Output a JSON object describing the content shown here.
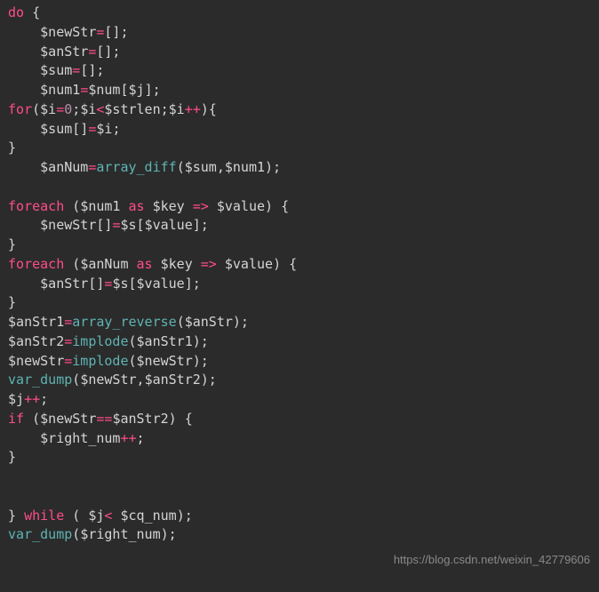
{
  "watermark": "https://blog.csdn.net/weixin_42779606",
  "lines": [
    " <span class='kw'>do</span> <span class='pun'>{</span>",
    "     <span class='var'>$newStr</span><span class='op'>=</span><span class='pun'>[];</span>",
    "     <span class='var'>$anStr</span><span class='op'>=</span><span class='pun'>[];</span>",
    "     <span class='var'>$sum</span><span class='op'>=</span><span class='pun'>[];</span>",
    "     <span class='var'>$num1</span><span class='op'>=</span><span class='var'>$num</span><span class='pun'>[</span><span class='var'>$j</span><span class='pun'>];</span>",
    " <span class='kw'>for</span><span class='pun'>(</span><span class='var'>$i</span><span class='op'>=</span><span class='num'>0</span><span class='pun'>;</span><span class='var'>$i</span><span class='op'>&lt;</span><span class='var'>$strlen</span><span class='pun'>;</span><span class='var'>$i</span><span class='op'>++</span><span class='pun'>){</span>",
    "     <span class='var'>$sum</span><span class='pun'>[]</span><span class='op'>=</span><span class='var'>$i</span><span class='pun'>;</span>",
    " <span class='pun'>}</span>",
    "     <span class='var'>$anNum</span><span class='op'>=</span><span class='call'>array_diff</span><span class='pun'>(</span><span class='var'>$sum</span><span class='pun'>,</span><span class='var'>$num1</span><span class='pun'>);</span>",
    "",
    " <span class='kw'>foreach</span> <span class='pun'>(</span><span class='var'>$num1</span> <span class='kw'>as</span> <span class='var'>$key</span> <span class='op'>=&gt;</span> <span class='var'>$value</span><span class='pun'>) {</span>",
    "     <span class='var'>$newStr</span><span class='pun'>[]</span><span class='op'>=</span><span class='var'>$s</span><span class='pun'>[</span><span class='var'>$value</span><span class='pun'>];</span>",
    " <span class='pun'>}</span>",
    " <span class='kw'>foreach</span> <span class='pun'>(</span><span class='var'>$anNum</span> <span class='kw'>as</span> <span class='var'>$key</span> <span class='op'>=&gt;</span> <span class='var'>$value</span><span class='pun'>) {</span>",
    "     <span class='var'>$anStr</span><span class='pun'>[]</span><span class='op'>=</span><span class='var'>$s</span><span class='pun'>[</span><span class='var'>$value</span><span class='pun'>];</span>",
    " <span class='pun'>}</span>",
    " <span class='var'>$anStr1</span><span class='op'>=</span><span class='call'>array_reverse</span><span class='pun'>(</span><span class='var'>$anStr</span><span class='pun'>);</span>",
    " <span class='var'>$anStr2</span><span class='op'>=</span><span class='call'>implode</span><span class='pun'>(</span><span class='var'>$anStr1</span><span class='pun'>);</span>",
    " <span class='var'>$newStr</span><span class='op'>=</span><span class='call'>implode</span><span class='pun'>(</span><span class='var'>$newStr</span><span class='pun'>);</span>",
    " <span class='call'>var_dump</span><span class='pun'>(</span><span class='var'>$newStr</span><span class='pun'>,</span><span class='var'>$anStr2</span><span class='pun'>);</span>",
    " <span class='var'>$j</span><span class='op'>++</span><span class='pun'>;</span>",
    " <span class='kw'>if</span> <span class='pun'>(</span><span class='var'>$newStr</span><span class='op'>==</span><span class='var'>$anStr2</span><span class='pun'>) {</span>",
    "     <span class='var'>$right_num</span><span class='op'>++</span><span class='pun'>;</span>",
    " <span class='pun'>}</span>",
    "",
    "",
    " <span class='pun'>}</span> <span class='kw'>while</span> <span class='pun'>(</span> <span class='var'>$j</span><span class='op'>&lt;</span> <span class='var'>$cq_num</span><span class='pun'>);</span>",
    " <span class='call'>var_dump</span><span class='pun'>(</span><span class='var'>$right_num</span><span class='pun'>);</span>",
    ""
  ]
}
